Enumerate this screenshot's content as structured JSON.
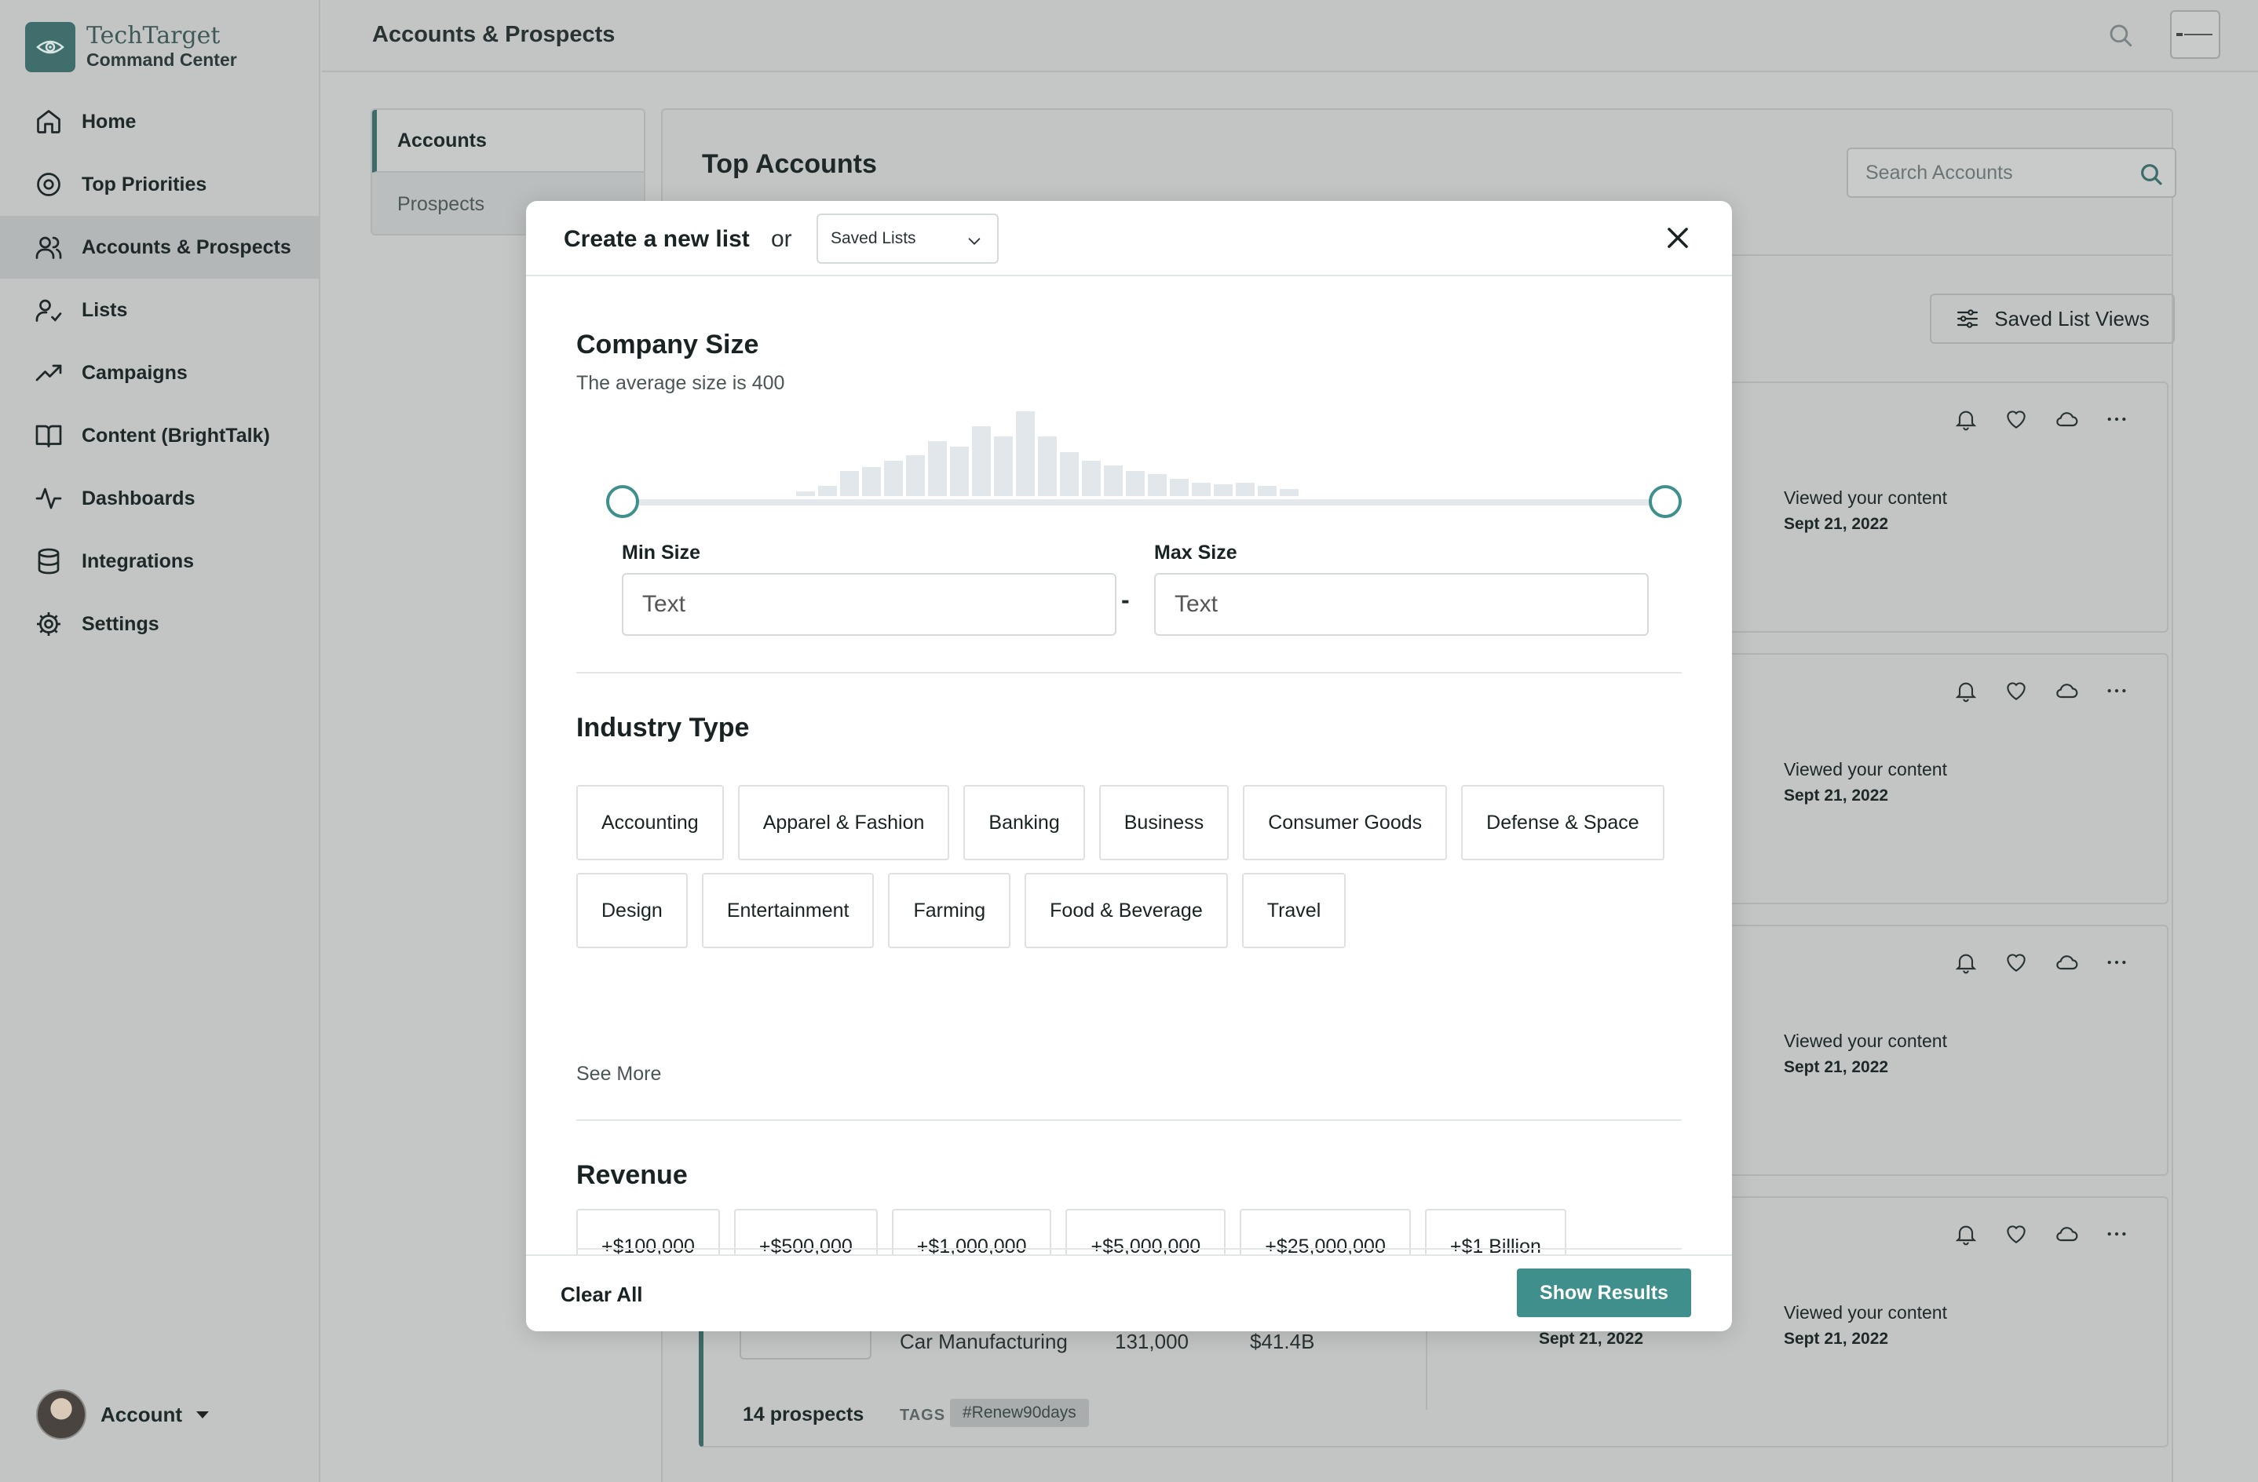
{
  "brand": {
    "name": "TechTarget",
    "subtitle": "Command Center"
  },
  "sidebar": {
    "items": [
      {
        "label": "Home",
        "icon": "home-icon"
      },
      {
        "label": "Top Priorities",
        "icon": "target-icon"
      },
      {
        "label": "Accounts & Prospects",
        "icon": "users-icon",
        "active": true
      },
      {
        "label": "Lists",
        "icon": "user-check-icon"
      },
      {
        "label": "Campaigns",
        "icon": "trending-up-icon"
      },
      {
        "label": "Content (BrightTalk)",
        "icon": "book-open-icon"
      },
      {
        "label": "Dashboards",
        "icon": "activity-icon"
      },
      {
        "label": "Integrations",
        "icon": "database-icon"
      },
      {
        "label": "Settings",
        "icon": "gear-icon"
      }
    ],
    "account_label": "Account"
  },
  "header": {
    "title": "Accounts & Prospects"
  },
  "subtabs": [
    {
      "label": "Accounts",
      "active": true
    },
    {
      "label": "Prospects",
      "active": false
    }
  ],
  "main": {
    "title": "Top Accounts",
    "search_placeholder": "Search Accounts",
    "saved_views_label": "Saved List Views",
    "cards": [
      {
        "viewed_label": "Viewed your content",
        "viewed_date": "Sept 21, 2022"
      },
      {
        "viewed_label": "Viewed your content",
        "viewed_date": "Sept 21, 2022"
      },
      {
        "viewed_label": "Viewed your content",
        "viewed_date": "Sept 21, 2022"
      },
      {
        "viewed_label": "Viewed your content",
        "viewed_date": "Sept 21, 2022",
        "industry": "Car Manufacturing",
        "employees": "131,000",
        "revenue": "$41.4B",
        "date2": "Sept 21, 2022",
        "prospects": "14 prospects",
        "tags_label": "TAGS",
        "tag": "#Renew90days"
      }
    ]
  },
  "modal": {
    "title": "Create a new list",
    "or_label": "or",
    "saved_lists_value": "Saved Lists",
    "company_size": {
      "title": "Company Size",
      "avg_text": "The average size is 400",
      "histogram": [
        0.06,
        0.12,
        0.3,
        0.34,
        0.42,
        0.48,
        0.65,
        0.58,
        0.82,
        0.7,
        1.0,
        0.7,
        0.52,
        0.42,
        0.36,
        0.3,
        0.26,
        0.2,
        0.16,
        0.14,
        0.16,
        0.12,
        0.08
      ],
      "min_label": "Min Size",
      "max_label": "Max Size",
      "min_placeholder": "Text",
      "max_placeholder": "Text",
      "dash": "-"
    },
    "industry": {
      "title": "Industry Type",
      "options": [
        "Accounting",
        "Apparel & Fashion",
        "Banking",
        "Business",
        "Consumer Goods",
        "Defense & Space",
        "Design",
        "Entertainment",
        "Farming",
        "Food & Beverage",
        "Travel"
      ],
      "see_more": "See More"
    },
    "revenue": {
      "title": "Revenue",
      "options": [
        "+$100,000",
        "+$500,000",
        "+$1,000,000",
        "+$5,000,000",
        "+$25,000,000",
        "+$1 Billion"
      ]
    },
    "footer": {
      "clear_label": "Clear All",
      "submit_label": "Show Results"
    }
  },
  "colors": {
    "accent": "#3f8f8d",
    "brand": "#3f6e6c",
    "overlay_bg": "#c3c5c5"
  }
}
